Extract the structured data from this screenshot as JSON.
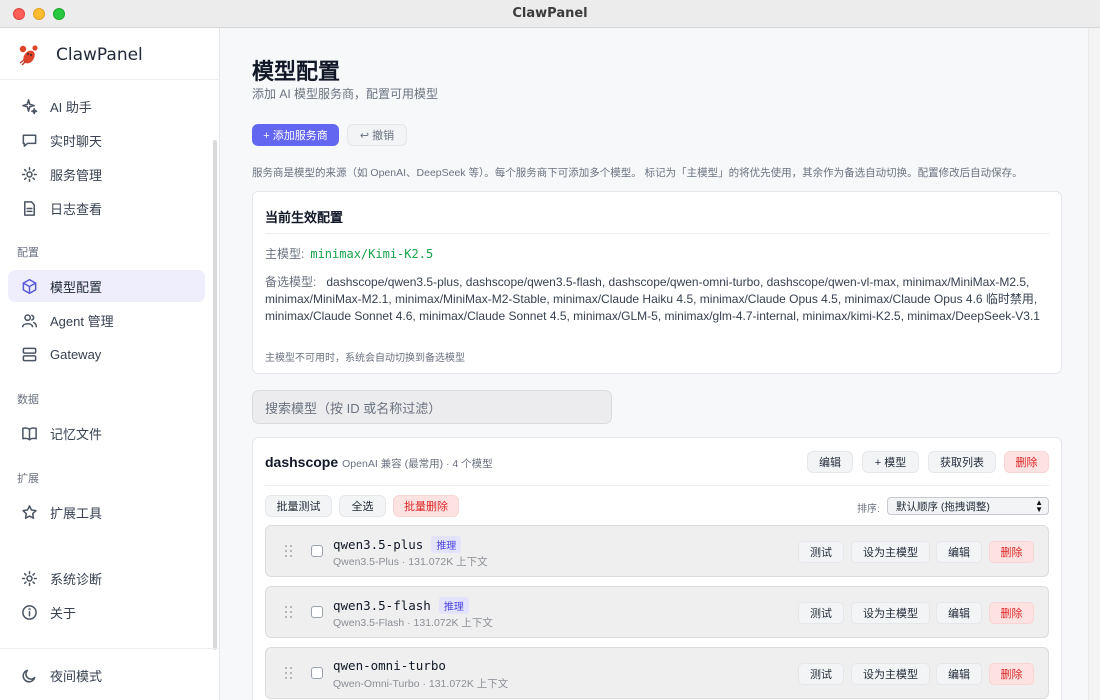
{
  "window": {
    "title": "ClawPanel"
  },
  "brand": {
    "name": "ClawPanel"
  },
  "nav": {
    "top": [
      {
        "label": "AI 助手",
        "icon": "sparkle-icon"
      },
      {
        "label": "实时聊天",
        "icon": "chat-icon"
      },
      {
        "label": "服务管理",
        "icon": "gear-icon"
      },
      {
        "label": "日志查看",
        "icon": "document-icon"
      }
    ],
    "config_section": "配置",
    "config": [
      {
        "label": "模型配置",
        "icon": "cube-icon",
        "active": true
      },
      {
        "label": "Agent 管理",
        "icon": "users-icon"
      },
      {
        "label": "Gateway",
        "icon": "server-icon"
      }
    ],
    "data_section": "数据",
    "data": [
      {
        "label": "记忆文件",
        "icon": "book-icon"
      }
    ],
    "ext_section": "扩展",
    "ext": [
      {
        "label": "扩展工具",
        "icon": "star-icon"
      }
    ],
    "bottom": [
      {
        "label": "系统诊断",
        "icon": "gear-icon"
      },
      {
        "label": "关于",
        "icon": "info-icon"
      }
    ],
    "night_mode": "夜间模式"
  },
  "page": {
    "title": "模型配置",
    "subtitle": "添加 AI 模型服务商，配置可用模型",
    "add_provider": "+ 添加服务商",
    "undo": "↩ 撤销",
    "hint": "服务商是模型的来源（如 OpenAI、DeepSeek 等）。每个服务商下可添加多个模型。 标记为「主模型」的将优先使用，其余作为备选自动切换。配置修改后自动保存。"
  },
  "active_config": {
    "title": "当前生效配置",
    "primary_label": "主模型:",
    "primary_value": "minimax/Kimi-K2.5",
    "fallback_label": "备选模型:",
    "fallback_value": "dashscope/qwen3.5-plus, dashscope/qwen3.5-flash, dashscope/qwen-omni-turbo, dashscope/qwen-vl-max, minimax/MiniMax-M2.5, minimax/MiniMax-M2.1, minimax/MiniMax-M2-Stable, minimax/Claude Haiku 4.5, minimax/Claude Opus 4.5, minimax/Claude Opus 4.6 临时禁用, minimax/Claude Sonnet 4.6, minimax/Claude Sonnet 4.5, minimax/GLM-5, minimax/glm-4.7-internal, minimax/kimi-K2.5, minimax/DeepSeek-V3.1",
    "note": "主模型不可用时，系统会自动切换到备选模型"
  },
  "search": {
    "placeholder": "搜索模型（按 ID 或名称过滤）"
  },
  "provider": {
    "name": "dashscope",
    "meta": "OpenAI 兼容 (最常用) · 4 个模型",
    "edit": "编辑",
    "add_model": "+ 模型",
    "fetch_list": "获取列表",
    "delete": "删除",
    "batch_test": "批量测试",
    "select_all": "全选",
    "batch_delete": "批量删除",
    "sort_label": "排序:",
    "sort_value": "默认顺序 (拖拽调整)",
    "models": [
      {
        "id": "qwen3.5-plus",
        "tag": "推理",
        "sub": "Qwen3.5-Plus · 131.072K 上下文"
      },
      {
        "id": "qwen3.5-flash",
        "tag": "推理",
        "sub": "Qwen3.5-Flash · 131.072K 上下文"
      },
      {
        "id": "qwen-omni-turbo",
        "tag": "",
        "sub": "Qwen-Omni-Turbo · 131.072K 上下文"
      }
    ],
    "row_actions": {
      "test": "测试",
      "set_primary": "设为主模型",
      "edit": "编辑",
      "delete": "删除"
    }
  },
  "colors": {
    "accent": "#6366f1",
    "primary_model": "#16a34a",
    "danger": "#dc2626"
  }
}
